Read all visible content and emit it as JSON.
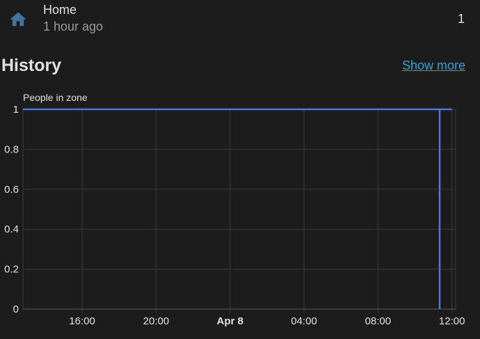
{
  "entity": {
    "icon": "home-icon",
    "name": "Home",
    "last_changed": "1 hour ago",
    "state": "1"
  },
  "history": {
    "title": "History",
    "show_more_label": "Show more"
  },
  "colors": {
    "background": "#1c1c1c",
    "icon": "#44739e",
    "link": "#2ea3d6",
    "series": "#4f76d9",
    "grid": "#3a3a3a"
  },
  "chart_data": {
    "type": "line",
    "series": [
      {
        "name": "People in zone",
        "points": [
          {
            "x": "Apr 7 12:00",
            "y": 1
          },
          {
            "x": "Apr 8 11:20",
            "y": 1
          },
          {
            "x": "Apr 8 11:20",
            "y": 0
          },
          {
            "x": "Apr 8 11:20",
            "y": 1
          },
          {
            "x": "Apr 8 12:00",
            "y": 1
          }
        ]
      }
    ],
    "x_ticks": [
      {
        "label": "16:00",
        "t": 16,
        "bold": false
      },
      {
        "label": "20:00",
        "t": 20,
        "bold": false
      },
      {
        "label": "Apr 8",
        "t": 24,
        "bold": true
      },
      {
        "label": "04:00",
        "t": 28,
        "bold": false
      },
      {
        "label": "08:00",
        "t": 32,
        "bold": false
      },
      {
        "label": "12:00",
        "t": 36,
        "bold": false
      }
    ],
    "y_ticks": [
      "0",
      "0.2",
      "0.4",
      "0.6",
      "0.8",
      "1"
    ],
    "ylim": [
      0,
      1
    ],
    "x_range_hours": [
      12.8,
      36.2
    ],
    "grid": true
  }
}
